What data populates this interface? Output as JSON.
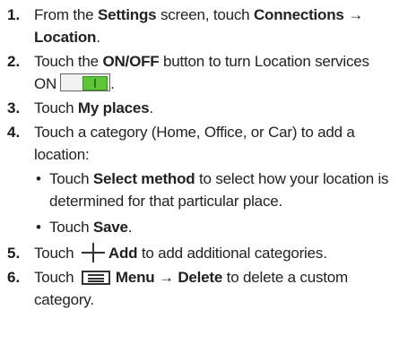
{
  "steps": [
    {
      "num": "1.",
      "t1": "From the ",
      "b1": "Settings",
      "t2": " screen, touch ",
      "b2": "Connections → Location",
      "t3": "."
    },
    {
      "num": "2.",
      "t1": "Touch the ",
      "b1": "ON/OFF",
      "t2": " button to turn Location services ON",
      "t3": "."
    },
    {
      "num": "3.",
      "t1": "Touch ",
      "b1": "My places",
      "t2": "."
    },
    {
      "num": "4.",
      "t1": "Touch a category (Home, Office, or Car) to add a location:"
    },
    {
      "num": "5.",
      "t1": "Touch ",
      "b1": "Add",
      "t2": " to add additional categories."
    },
    {
      "num": "6.",
      "t1": "Touch ",
      "b1": "Menu → Delete",
      "t2": " to delete a custom category."
    }
  ],
  "substeps": [
    {
      "bullet": "•",
      "t1": "Touch ",
      "b1": "Select method",
      "t2": " to select how your location is determined for that particular place."
    },
    {
      "bullet": "•",
      "t1": "Touch ",
      "b1": "Save",
      "t2": "."
    }
  ],
  "icons": {
    "toggle": "on-off-toggle-icon",
    "add": "plus-icon",
    "menu": "menu-icon"
  },
  "colors": {
    "toggle_on": "#5cc636"
  }
}
